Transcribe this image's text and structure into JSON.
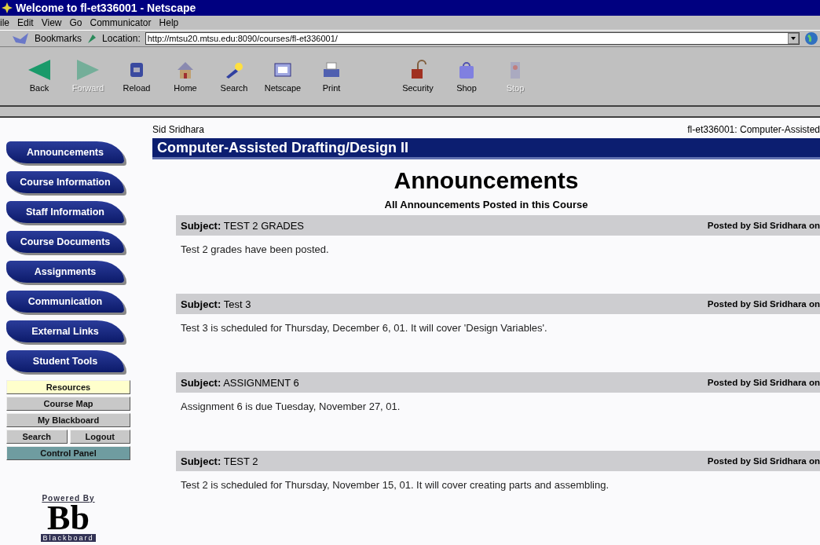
{
  "window": {
    "title": "Welcome to fl-et336001 - Netscape"
  },
  "menu": [
    "ile",
    "Edit",
    "View",
    "Go",
    "Communicator",
    "Help"
  ],
  "location_bar": {
    "bookmarks": "Bookmarks",
    "label": "Location:",
    "url": "http://mtsu20.mtsu.edu:8090/courses/fl-et336001/"
  },
  "toolbar": [
    {
      "kind": "back",
      "label": "Back",
      "disabled": false
    },
    {
      "kind": "forward",
      "label": "Forward",
      "disabled": true
    },
    {
      "kind": "reload",
      "label": "Reload",
      "disabled": false
    },
    {
      "kind": "home",
      "label": "Home",
      "disabled": false
    },
    {
      "kind": "search",
      "label": "Search",
      "disabled": false
    },
    {
      "kind": "my",
      "label": "Netscape",
      "disabled": false
    },
    {
      "kind": "print",
      "label": "Print",
      "disabled": false
    },
    {
      "kind": "security",
      "label": "Security",
      "disabled": false
    },
    {
      "kind": "shop",
      "label": "Shop",
      "disabled": false
    },
    {
      "kind": "stop",
      "label": "Stop",
      "disabled": true
    }
  ],
  "sidebar": {
    "tabs": [
      "Announcements",
      "Course Information",
      "Staff Information",
      "Course Documents",
      "Assignments",
      "Communication",
      "External Links",
      "Student Tools"
    ],
    "links": [
      {
        "kind": "resources",
        "labels": [
          "Resources"
        ]
      },
      {
        "kind": "plain",
        "labels": [
          "Course Map"
        ]
      },
      {
        "kind": "plain",
        "labels": [
          "My Blackboard"
        ]
      },
      {
        "kind": "plain",
        "labels": [
          "Search",
          "Logout"
        ]
      },
      {
        "kind": "panel",
        "labels": [
          "Control Panel"
        ]
      }
    ],
    "logo": {
      "caption": "Powered By",
      "letters": "Bb",
      "name": "Blackboard"
    }
  },
  "page": {
    "user": "Sid Sridhara",
    "course_id": "fl-et336001: Computer-Assisted",
    "course_title": "Computer-Assisted Drafting/Design II",
    "heading": "Announcements",
    "subheading": "All Announcements Posted in this Course",
    "announcements": [
      {
        "subject_label": "Subject:",
        "subject": "TEST 2 GRADES",
        "posted": "Posted by Sid Sridhara on",
        "body": "Test 2 grades have been posted."
      },
      {
        "subject_label": "Subject:",
        "subject": "Test 3",
        "posted": "Posted by Sid Sridhara on",
        "body": "Test 3 is scheduled for Thursday, December 6, 01. It will cover 'Design Variables'."
      },
      {
        "subject_label": "Subject:",
        "subject": "ASSIGNMENT 6",
        "posted": "Posted by Sid Sridhara on",
        "body": "Assignment 6 is due Tuesday, November 27, 01."
      },
      {
        "subject_label": "Subject:",
        "subject": "TEST 2",
        "posted": "Posted by Sid Sridhara on",
        "body": "Test 2 is scheduled for Thursday, November 15, 01. It will cover creating parts and assembling."
      }
    ]
  }
}
